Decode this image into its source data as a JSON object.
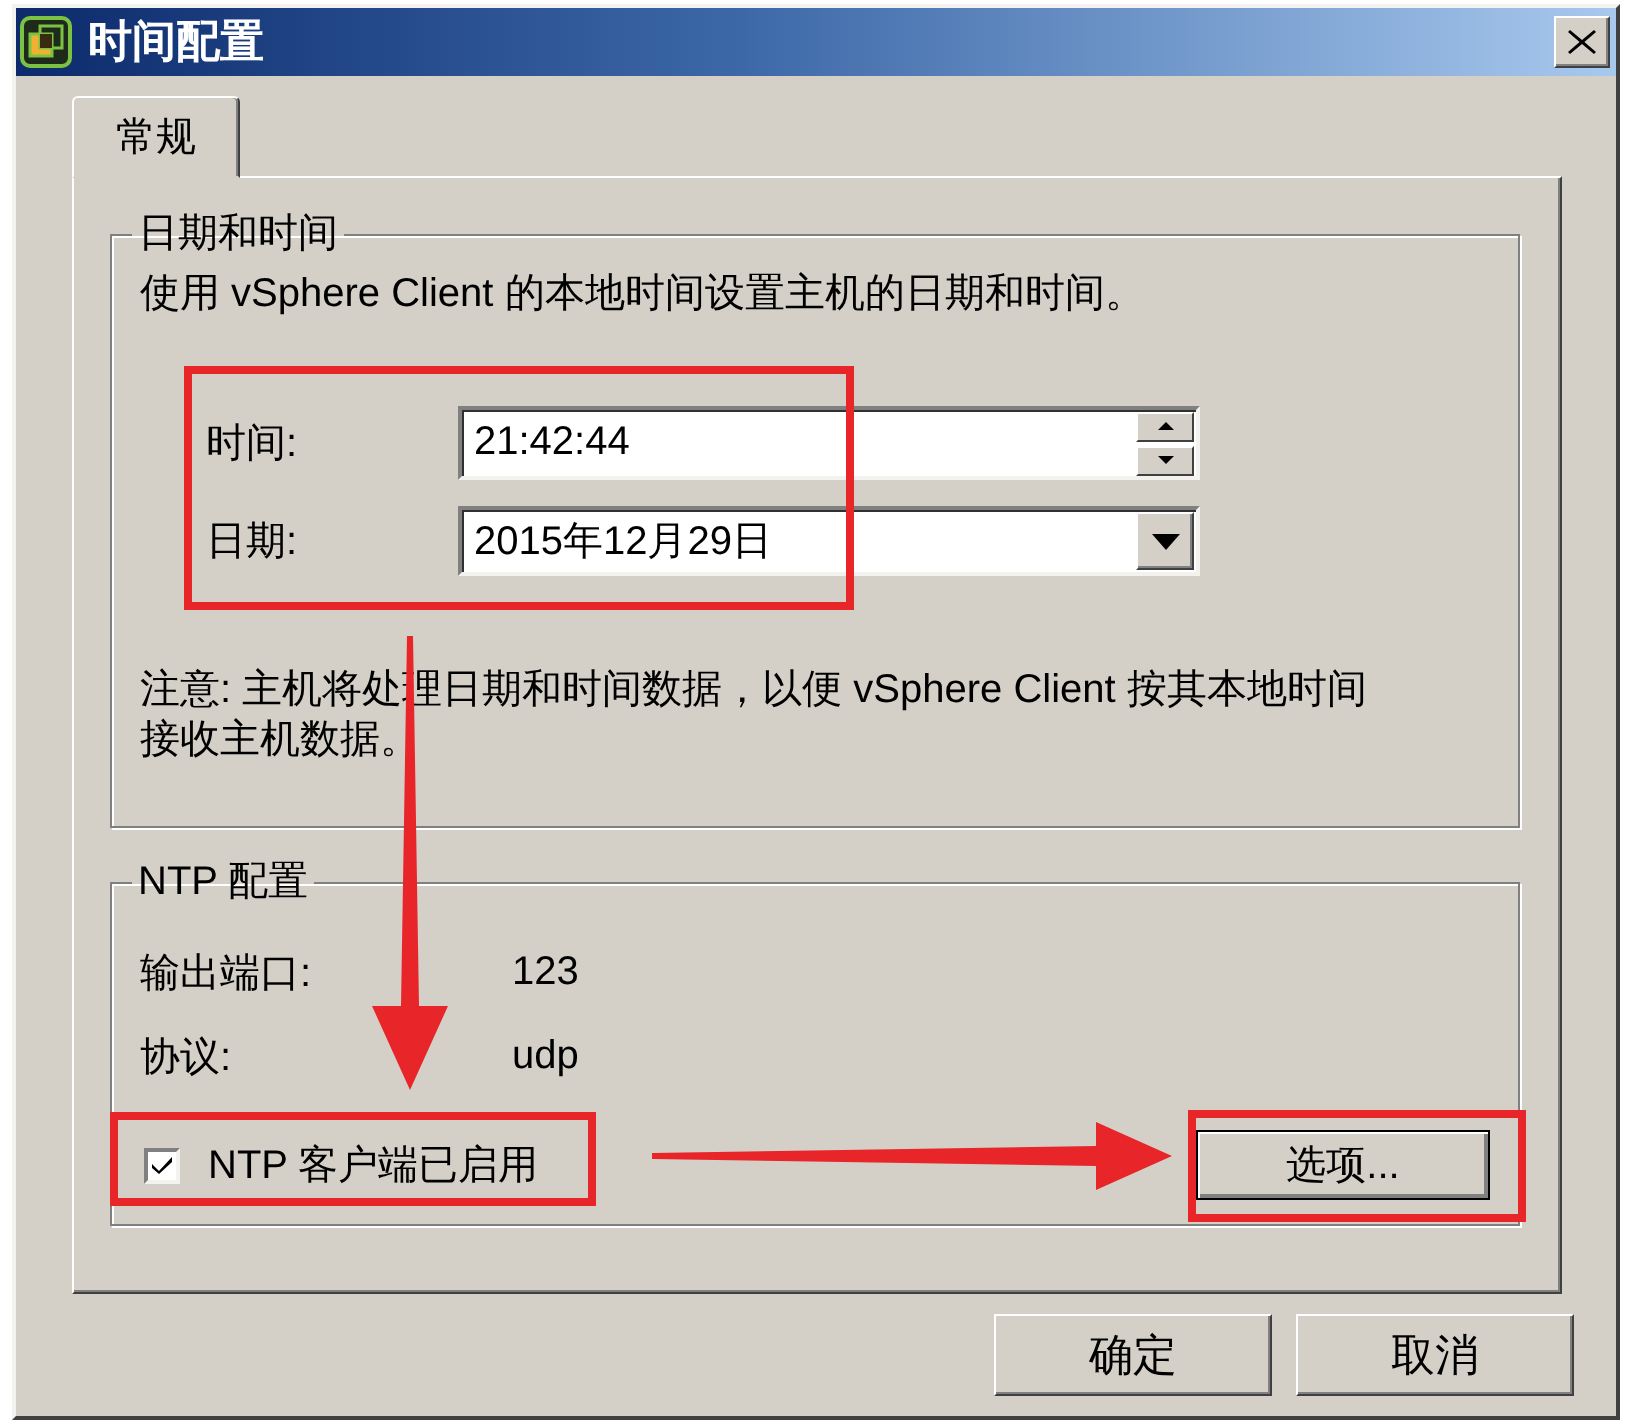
{
  "window": {
    "title": "时间配置"
  },
  "tabs": [
    {
      "label": "常规",
      "selected": true
    }
  ],
  "date_time_group": {
    "title": "日期和时间",
    "description": "使用 vSphere Client 的本地时间设置主机的日期和时间。",
    "fields": [
      {
        "kind": "spinner",
        "label": "时间:",
        "value": "21:42:44"
      },
      {
        "kind": "dropdown",
        "label": "日期:",
        "value": "2015年12月29日"
      }
    ],
    "note": "注意: 主机将处理日期和时间数据，以便 vSphere Client 按其本地时间接收主机数据。"
  },
  "ntp_group": {
    "title": "NTP 配置",
    "rows": [
      {
        "label": "输出端口:",
        "value": "123"
      },
      {
        "label": "协议:",
        "value": "udp"
      }
    ],
    "client_checkbox": {
      "label": "NTP 客户端已启用",
      "checked": true
    },
    "options_button": "选项..."
  },
  "buttons": [
    "确定",
    "取消"
  ]
}
